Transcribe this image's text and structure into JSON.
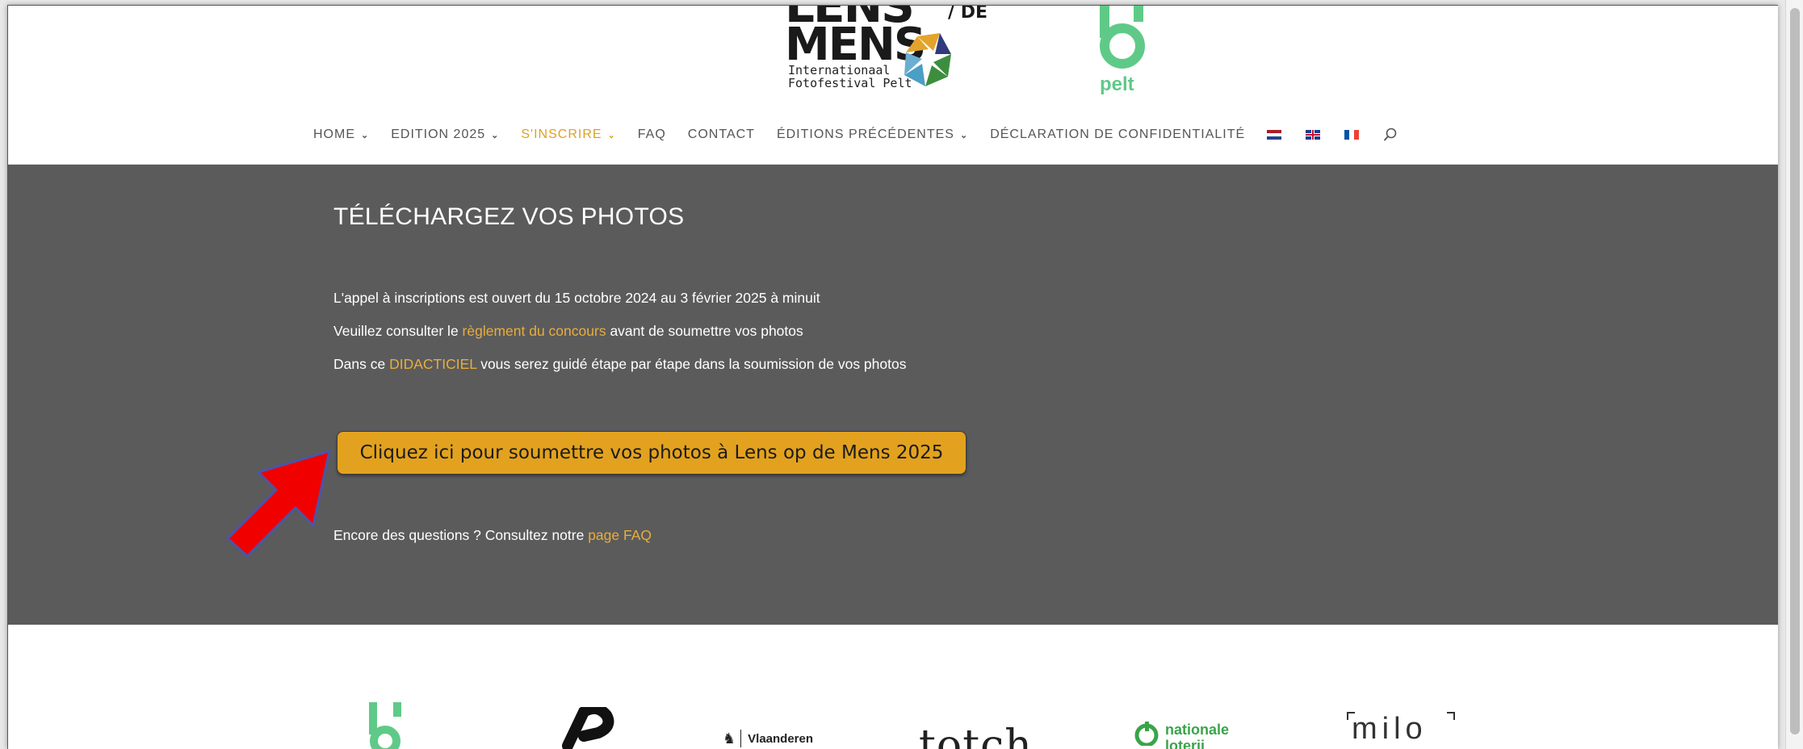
{
  "header": {
    "logo_lens": {
      "line1": "LENS",
      "line2": "MENS",
      "op": "/ DE",
      "sub1": "Internationaal",
      "sub2": "Fotofestival Pelt"
    },
    "logo_pelt": {
      "word": "pelt",
      "color": "#5fca88"
    }
  },
  "nav": {
    "items": [
      {
        "label": "HOME",
        "dropdown": true,
        "active": false
      },
      {
        "label": "EDITION 2025",
        "dropdown": true,
        "active": false
      },
      {
        "label": "S'INSCRIRE",
        "dropdown": true,
        "active": true
      },
      {
        "label": "FAQ",
        "dropdown": false,
        "active": false
      },
      {
        "label": "CONTACT",
        "dropdown": false,
        "active": false
      },
      {
        "label": "ÉDITIONS PRÉCÉDENTES",
        "dropdown": true,
        "active": false
      },
      {
        "label": "DÉCLARATION DE CONFIDENTIALITÉ",
        "dropdown": false,
        "active": false
      }
    ],
    "chevron": "⌄",
    "flags": [
      "flag-nl-icon",
      "flag-uk-icon",
      "flag-fr-icon"
    ],
    "active_color": "#e0a021"
  },
  "main": {
    "title": "TÉLÉCHARGEZ VOS PHOTOS",
    "line1": "L'appel à inscriptions est ouvert du 15 octobre 2024 au 3 février 2025 à minuit",
    "line2_pre": "Veuillez consulter le ",
    "line2_link": "règlement du concours",
    "line2_post": " avant de soumettre vos photos",
    "line3_pre": "Dans ce ",
    "line3_link": "DIDACTICIEL",
    "line3_post": " vous serez guidé étape par étape dans la soumission de vos photos",
    "cta": "Cliquez ici pour soumettre vos photos à Lens op de Mens 2025",
    "line4_pre": "Encore des questions ? Consultez notre ",
    "line4_link": "page FAQ",
    "bg_color": "#5b5b5b",
    "cta_color": "#e2a21f",
    "link_color": "#e8ad3e"
  },
  "sponsors": {
    "vlaanderen": "Vlaanderen",
    "totch": "totch",
    "loterij_line1": "nationale",
    "loterij_line2": "loterij",
    "milo": "milo"
  }
}
